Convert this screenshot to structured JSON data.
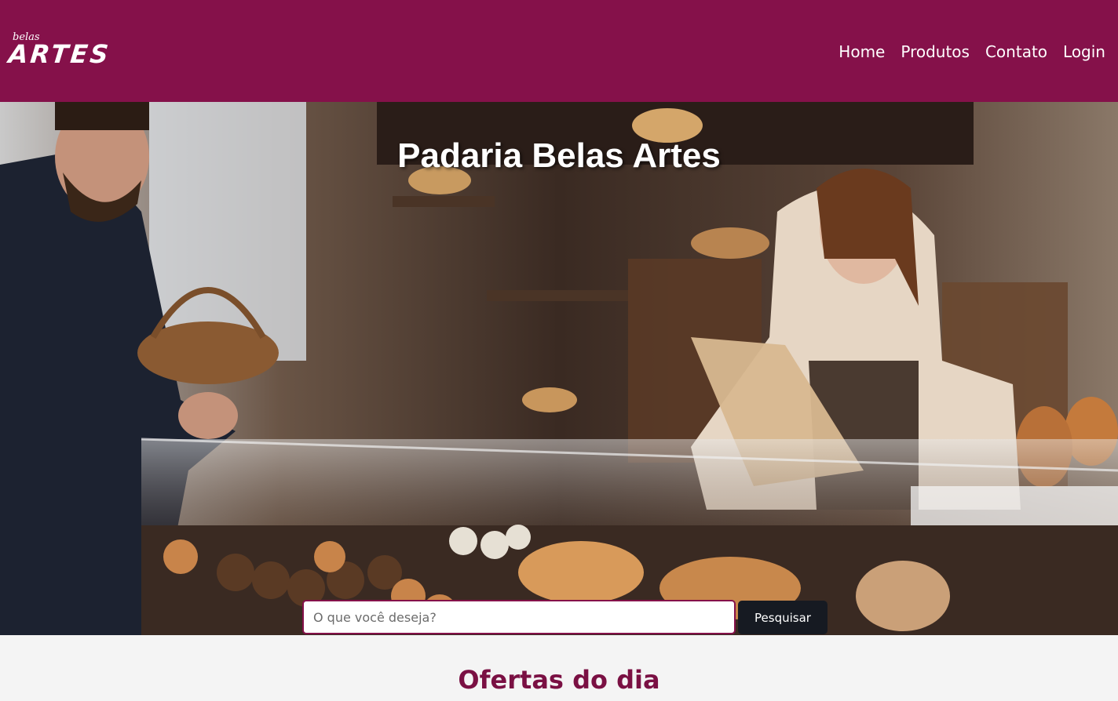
{
  "header": {
    "logo": {
      "small": "belas",
      "big": "ARTES"
    },
    "nav": [
      {
        "label": "Home"
      },
      {
        "label": "Produtos"
      },
      {
        "label": "Contato"
      },
      {
        "label": "Login"
      }
    ]
  },
  "hero": {
    "title": "Padaria Belas Artes"
  },
  "search": {
    "placeholder": "O que você deseja?",
    "button_label": "Pesquisar"
  },
  "offers": {
    "title": "Ofertas do dia"
  },
  "colors": {
    "brand": "#85114a",
    "button_dark": "#161a22",
    "section_title": "#7a1043"
  }
}
